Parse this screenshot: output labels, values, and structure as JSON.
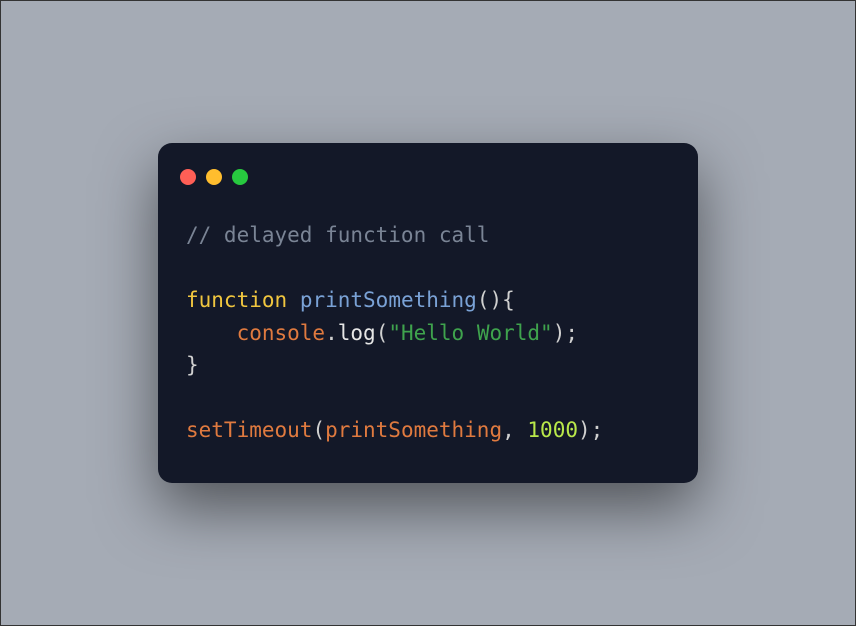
{
  "titlebar": {
    "buttons": [
      "close",
      "minimize",
      "zoom"
    ]
  },
  "code": {
    "line1_comment": "// delayed function call",
    "line3_keyword": "function",
    "line3_name": "printSomething",
    "line3_after": "(){",
    "line4_indent": "    ",
    "line4_obj": "console",
    "line4_dot": ".",
    "line4_method": "log",
    "line4_open": "(",
    "line4_string": "\"Hello World\"",
    "line4_close": ");",
    "line5_brace": "}",
    "line7_call": "setTimeout",
    "line7_open": "(",
    "line7_arg1": "printSomething",
    "line7_comma": ", ",
    "line7_num": "1000",
    "line7_close": ");"
  }
}
